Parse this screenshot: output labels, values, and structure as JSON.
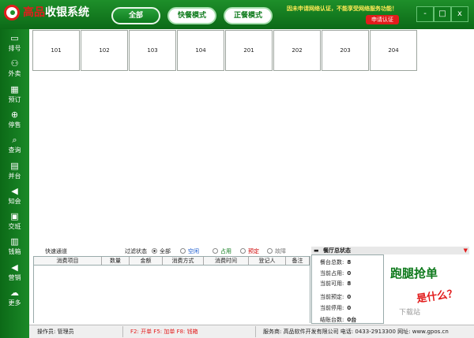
{
  "titlebar": {
    "title_brand": "高品",
    "title_rest": "收银系统",
    "modes": [
      "全部",
      "快餐模式",
      "正餐模式"
    ],
    "notice": "因未申请网络认证，不能享受网络服务功能！",
    "apply_label": "申请认证",
    "window_controls": [
      "-",
      "□",
      "x"
    ],
    "colors": {
      "brand": "#e21c1c",
      "bar": "#0f7a1d"
    }
  },
  "sidebar": [
    {
      "label": "排号",
      "icon": "laptop-icon",
      "glyph": "▭"
    },
    {
      "label": "外卖",
      "icon": "delivery-icon",
      "glyph": "⚇"
    },
    {
      "label": "预订",
      "icon": "calendar-icon",
      "glyph": "▦"
    },
    {
      "label": "停售",
      "icon": "target-icon",
      "glyph": "⊕"
    },
    {
      "label": "查询",
      "icon": "search-icon",
      "glyph": "⌕"
    },
    {
      "label": "并台",
      "icon": "book-icon",
      "glyph": "▤"
    },
    {
      "label": "知会",
      "icon": "megaphone-icon",
      "glyph": "◀"
    },
    {
      "label": "交班",
      "icon": "lock-icon",
      "glyph": "▣"
    },
    {
      "label": "钱箱",
      "icon": "open-book-icon",
      "glyph": "▥"
    },
    {
      "label": "营销",
      "icon": "megaphone-icon",
      "glyph": "◀"
    },
    {
      "label": "更多",
      "icon": "cloud-icon",
      "glyph": "☁"
    }
  ],
  "tables": [
    "101",
    "102",
    "103",
    "104",
    "201",
    "202",
    "203",
    "204"
  ],
  "filter": {
    "quick_label": "快速通道",
    "filter_label": "过滤状态",
    "options": [
      "全部",
      "空闲",
      "占用",
      "预定",
      "故障"
    ],
    "selected": "全部"
  },
  "records": {
    "columns": [
      "消费项目",
      "数量",
      "金额",
      "消费方式",
      "消费时间",
      "登记人",
      "备注"
    ]
  },
  "status": {
    "header": "餐厅总状态",
    "rows": [
      {
        "label": "餐台总数:",
        "value": "8"
      },
      {
        "label": "当前占用:",
        "value": "0"
      },
      {
        "label": "当前可用:",
        "value": "8"
      },
      {
        "label": "当前预定:",
        "value": "0"
      },
      {
        "label": "当前停用:",
        "value": "0"
      },
      {
        "label": "结账台数:",
        "value": "0台"
      }
    ]
  },
  "promo": {
    "line1": "跑腿抢单",
    "line2": "是什么？",
    "watermark": "下载站"
  },
  "footer": {
    "operator": "操作员:  管理员",
    "hotkeys": "F2: 开单   F5: 加单   F8: 钱箱",
    "vendor": "服务商: 高品软件开发有限公司   电话: 0433-2913300  网址: www.gpos.cn"
  }
}
